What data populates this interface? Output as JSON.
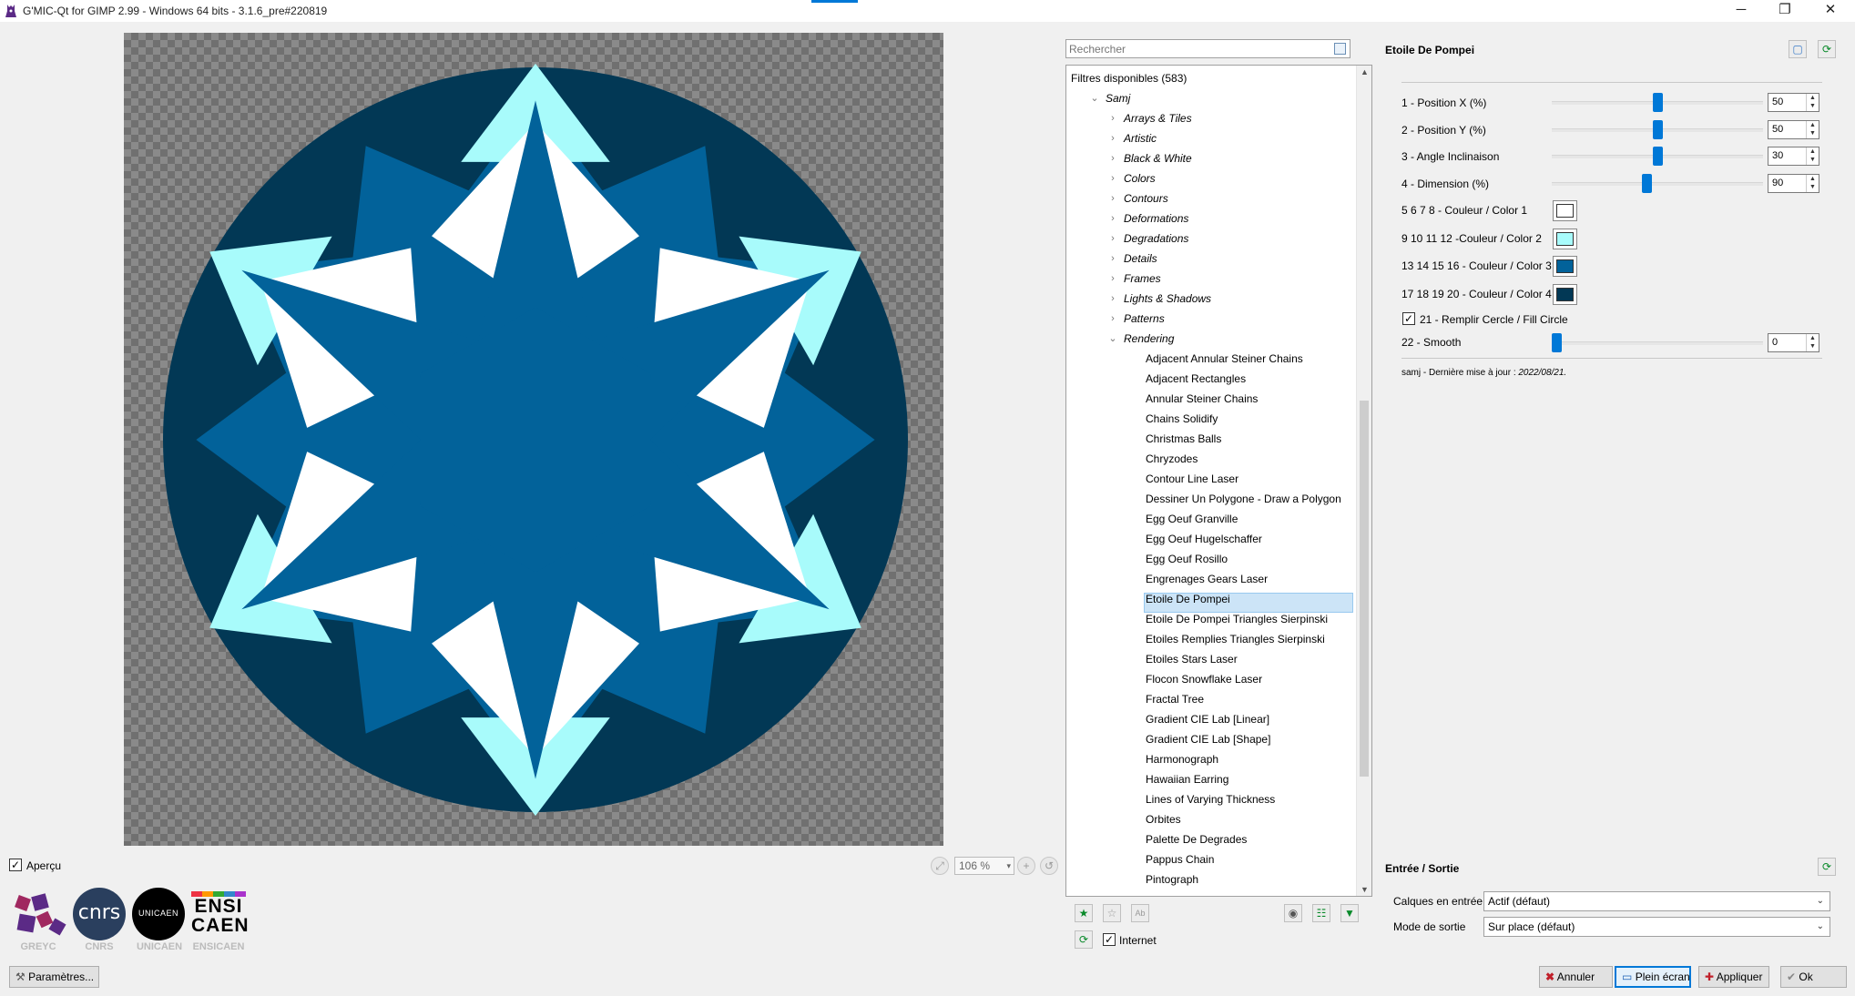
{
  "window": {
    "title": "G'MIC-Qt for GIMP 2.99 - Windows 64 bits - 3.1.6_pre#220819",
    "minimize_glyph": "─",
    "maximize_glyph": "❐",
    "close_glyph": "✕"
  },
  "preview": {
    "checkbox_label": "Aperçu",
    "checked": true,
    "zoom_value": "106 %",
    "colors": {
      "color1": "#ffffff",
      "color2": "#a8fbfb",
      "color3": "#02629a",
      "color4": "#023855"
    }
  },
  "logos": {
    "greyc_caption": "GREYC",
    "cnrs_text": "cnrs",
    "cnrs_caption": "CNRS",
    "unicaen_text": "UNICAEN",
    "unicaen_caption": "UNICAEN",
    "ensicaen_text_1": "ENSI",
    "ensicaen_text_2": "CAEN",
    "ensicaen_caption": "ENSICAEN"
  },
  "settings_button": {
    "label": "Paramètres...",
    "icon": "wrench-icon"
  },
  "filters": {
    "search_placeholder": "Rechercher",
    "root_label": "Filtres disponibles (583)",
    "group": "Samj",
    "categories": [
      "Arrays & Tiles",
      "Artistic",
      "Black & White",
      "Colors",
      "Contours",
      "Deformations",
      "Degradations",
      "Details",
      "Frames",
      "Lights & Shadows",
      "Patterns",
      "Rendering"
    ],
    "rendering_items": [
      "Adjacent Annular Steiner Chains",
      "Adjacent Rectangles",
      "Annular Steiner Chains",
      "Chains Solidify",
      "Christmas Balls",
      "Chryzodes",
      "Contour Line Laser",
      "Dessiner Un Polygone - Draw a Polygon",
      "Egg Oeuf Granville",
      "Egg Oeuf Hugelschaffer",
      "Egg Oeuf Rosillo",
      "Engrenages Gears Laser",
      "Etoile De Pompei",
      "Etoile De Pompei Triangles Sierpinski",
      "Etoiles Remplies Triangles Sierpinski",
      "Etoiles Stars Laser",
      "Flocon Snowflake Laser",
      "Fractal Tree",
      "Gradient CIE Lab [Linear]",
      "Gradient CIE Lab [Shape]",
      "Harmonograph",
      "Hawaiian Earring",
      "Lines of Varying Thickness",
      "Orbites",
      "Palette De Degrades",
      "Pappus Chain",
      "Pintograph"
    ],
    "selected": "Etoile De Pompei",
    "internet_label": "Internet",
    "internet_checked": true
  },
  "params": {
    "title": "Etoile De Pompei",
    "sliders": [
      {
        "label": "1 - Position X (%)",
        "value": "50",
        "fraction": 0.5
      },
      {
        "label": "2 - Position Y (%)",
        "value": "50",
        "fraction": 0.5
      },
      {
        "label": "3 - Angle Inclinaison",
        "value": "30",
        "fraction": 0.5
      },
      {
        "label": "4 - Dimension (%)",
        "value": "90",
        "fraction": 0.45
      }
    ],
    "colors": [
      {
        "label": "5 6 7 8 - Couleur / Color 1",
        "color": "#ffffff"
      },
      {
        "label": "9 10 11 12 -Couleur / Color 2",
        "color": "#a8fbfb"
      },
      {
        "label": "13 14 15 16 - Couleur / Color 3",
        "color": "#02629a"
      },
      {
        "label": "17 18 19 20 - Couleur / Color 4",
        "color": "#023855"
      }
    ],
    "fill_circle_label": "21 - Remplir Cercle / Fill Circle",
    "fill_circle_checked": true,
    "smooth": {
      "label": "22 - Smooth",
      "value": "0",
      "fraction": 0.0
    },
    "note_prefix": "samj - Dernière mise à jour : ",
    "note_date": "2022/08/21."
  },
  "io": {
    "title": "Entrée / Sortie",
    "input_label": "Calques en entrée",
    "input_value": "Actif (défaut)",
    "output_label": "Mode de sortie",
    "output_value": "Sur place (défaut)"
  },
  "buttons": {
    "cancel": "Annuler",
    "fullscreen": "Plein écran",
    "apply": "Appliquer",
    "ok": "Ok"
  }
}
